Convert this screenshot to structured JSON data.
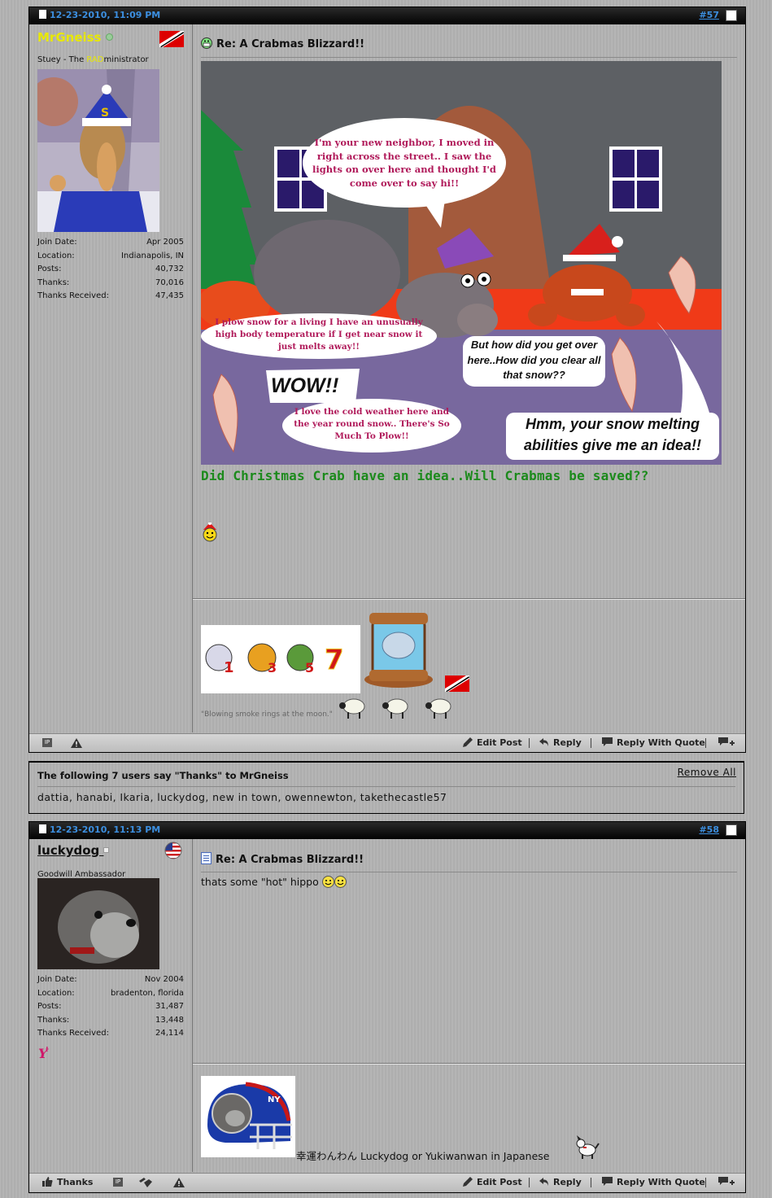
{
  "post1": {
    "date": "12-23-2010, 11:09 PM",
    "number": "#57",
    "username": "MrGneiss",
    "usertitle_pre": "Stuey - The ",
    "usertitle_rad": "RAD",
    "usertitle_post": "ministrator",
    "stats": [
      {
        "label": "Join Date:",
        "value": "Apr 2005"
      },
      {
        "label": "Location:",
        "value": "Indianapolis, IN"
      },
      {
        "label": "Posts:",
        "value": "40,732"
      },
      {
        "label": "Thanks:",
        "value": "70,016"
      },
      {
        "label": "Thanks Received:",
        "value": "47,435"
      }
    ],
    "title": "Re: A Crabmas Blizzard!!",
    "comic": {
      "bubble1": "I'm your new neighbor, I moved in right across the street.. I saw the lights on over here and thought I'd come over to say hi!!",
      "bubble2": "I plow snow for a living I have an unusually high body temperature if I get near snow it just melts away!!",
      "wow": "WOW!!",
      "bubble3": "I love the cold weather here and the year round snow.. There's So Much To Plow!!",
      "bubble4": "But how did you get over here..How did you clear all that snow??",
      "bubble5": "Hmm, your snow melting abilities give me an idea!!"
    },
    "body_text": "Did Christmas Crab have an idea..Will Crabmas be saved??",
    "sig_quote": "\"Blowing smoke rings at the moon.\"",
    "footer": {
      "edit": "Edit Post",
      "reply": "Reply",
      "quote": "Reply With Quote"
    }
  },
  "thanks": {
    "title": "The following 7 users say \"Thanks\" to MrGneiss",
    "remove": "Remove All",
    "users": [
      "dattia",
      "hanabi",
      "Ikaria",
      "luckydog",
      "new in town",
      "owennewton",
      "takethecastle57"
    ]
  },
  "post2": {
    "date": "12-23-2010, 11:13 PM",
    "number": "#58",
    "username": "luckydog",
    "usertitle": "Goodwill Ambassador",
    "stats": [
      {
        "label": "Join Date:",
        "value": "Nov 2004"
      },
      {
        "label": "Location:",
        "value": "bradenton, florida"
      },
      {
        "label": "Posts:",
        "value": "31,487"
      },
      {
        "label": "Thanks:",
        "value": "13,448"
      },
      {
        "label": "Thanks Received:",
        "value": "24,114"
      }
    ],
    "title": "Re: A Crabmas Blizzard!!",
    "body_text": "thats some \"hot\" hippo",
    "sig_text": "幸運わんわん Luckydog or Yukiwanwan in Japanese",
    "footer": {
      "thanks": "Thanks",
      "edit": "Edit Post",
      "reply": "Reply",
      "quote": "Reply With Quote"
    }
  },
  "colors": {
    "link_blue": "#3c8fe0",
    "username_yellow": "#e8e800",
    "body_green": "#1c8a1c"
  }
}
